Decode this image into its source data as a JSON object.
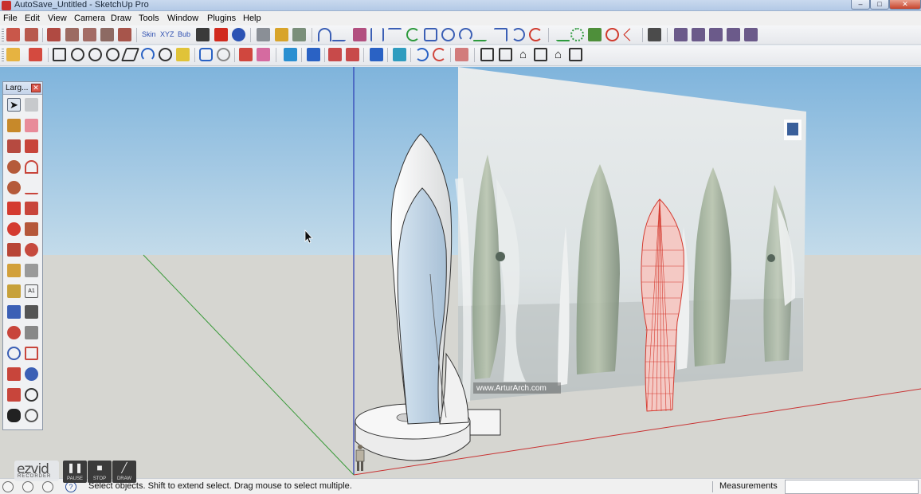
{
  "window": {
    "title": "AutoSave_Untitled - SketchUp Pro",
    "controls": {
      "minimize": "–",
      "maximize": "□",
      "close": "✕"
    }
  },
  "menu": [
    "File",
    "Edit",
    "View",
    "Camera",
    "Draw",
    "Tools",
    "Window",
    "Plugins",
    "Help"
  ],
  "toolbar1": {
    "plugin_labels": [
      "Skin",
      "XYZ",
      "Bub"
    ]
  },
  "palette": {
    "title": "Larg...",
    "close": "✕"
  },
  "viewport": {
    "sky_color": "#a7cbe6",
    "ground_color": "#d6d6d1",
    "axis_colors": {
      "red": "#c83232",
      "green": "#3a9a3a",
      "blue": "#2a3bb4"
    },
    "reference_image": {
      "watermark": "www.ArturArch.com"
    }
  },
  "status": {
    "icons": [
      "geo-location-icon",
      "credits-icon",
      "user-icon",
      "help-icon"
    ],
    "help_glyph": "?",
    "message": "Select objects. Shift to extend select. Drag mouse to select multiple.",
    "measurements_label": "Measurements",
    "measurements_value": ""
  },
  "recorder": {
    "logo": "ezvid",
    "logo_sub": "RECORDER",
    "buttons": [
      {
        "label": "PAUSE",
        "glyph": "❚❚"
      },
      {
        "label": "STOP",
        "glyph": "■"
      },
      {
        "label": "DRAW",
        "glyph": "╱"
      }
    ]
  }
}
